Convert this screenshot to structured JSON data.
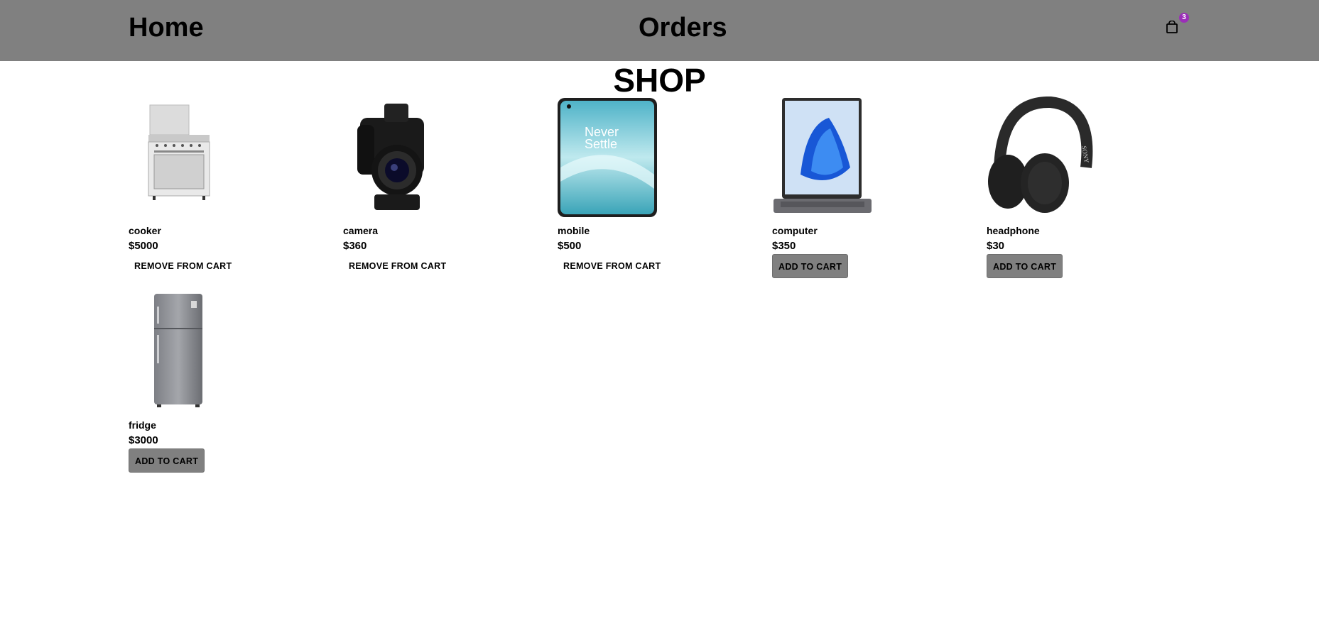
{
  "nav": {
    "home": "Home",
    "orders": "Orders",
    "cart_count": "3"
  },
  "page": {
    "title": "SHOP"
  },
  "products": [
    {
      "name": "cooker",
      "price": "$5000",
      "action": "REMOVE FROM CART",
      "in_cart": true,
      "image": "cooker-image"
    },
    {
      "name": "camera",
      "price": "$360",
      "action": "REMOVE FROM CART",
      "in_cart": true,
      "image": "camera-image"
    },
    {
      "name": "mobile",
      "price": "$500",
      "action": "REMOVE FROM CART",
      "in_cart": true,
      "image": "mobile-image",
      "screen_text": [
        "Never",
        "Settle"
      ]
    },
    {
      "name": "computer",
      "price": "$350",
      "action": "ADD TO CART",
      "in_cart": false,
      "image": "computer-image"
    },
    {
      "name": "headphone",
      "price": "$30",
      "action": "ADD TO CART",
      "in_cart": false,
      "image": "headphone-image",
      "brand_text": "SONY"
    },
    {
      "name": "fridge",
      "price": "$3000",
      "action": "ADD TO CART",
      "in_cart": false,
      "image": "fridge-image"
    }
  ],
  "colors": {
    "navbar": "#808080",
    "badge": "#9b2fb8",
    "button": "#808080"
  }
}
